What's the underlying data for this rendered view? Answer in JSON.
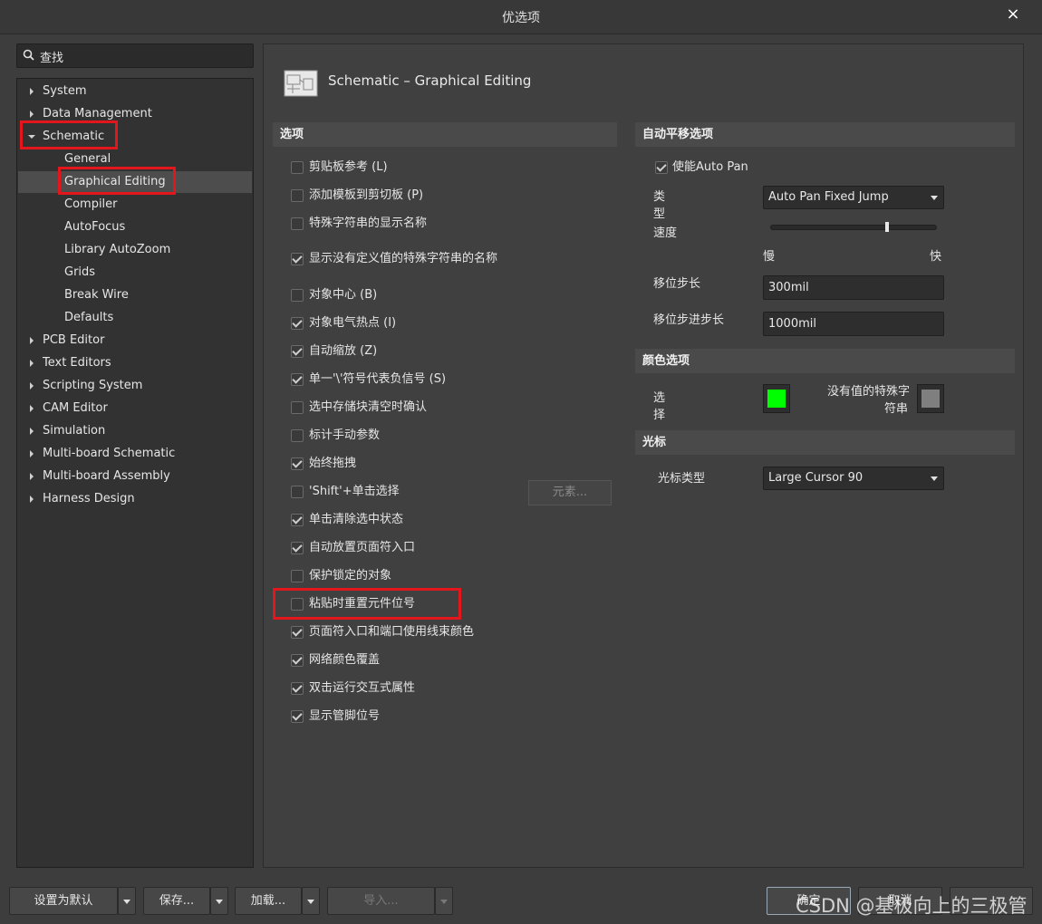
{
  "window": {
    "title": "优选项",
    "close": "×"
  },
  "search": {
    "placeholder": "查找"
  },
  "tree": [
    {
      "label": "System",
      "level": 0,
      "state": "collapsed"
    },
    {
      "label": "Data Management",
      "level": 0,
      "state": "collapsed"
    },
    {
      "label": "Schematic",
      "level": 0,
      "state": "expanded"
    },
    {
      "label": "General",
      "level": 1
    },
    {
      "label": "Graphical Editing",
      "level": 1,
      "selected": true
    },
    {
      "label": "Compiler",
      "level": 1
    },
    {
      "label": "AutoFocus",
      "level": 1
    },
    {
      "label": "Library AutoZoom",
      "level": 1
    },
    {
      "label": "Grids",
      "level": 1
    },
    {
      "label": "Break Wire",
      "level": 1
    },
    {
      "label": "Defaults",
      "level": 1
    },
    {
      "label": "PCB Editor",
      "level": 0,
      "state": "collapsed"
    },
    {
      "label": "Text Editors",
      "level": 0,
      "state": "collapsed"
    },
    {
      "label": "Scripting System",
      "level": 0,
      "state": "collapsed"
    },
    {
      "label": "CAM Editor",
      "level": 0,
      "state": "collapsed"
    },
    {
      "label": "Simulation",
      "level": 0,
      "state": "collapsed"
    },
    {
      "label": "Multi-board Schematic",
      "level": 0,
      "state": "collapsed"
    },
    {
      "label": "Multi-board Assembly",
      "level": 0,
      "state": "collapsed"
    },
    {
      "label": "Harness Design",
      "level": 0,
      "state": "collapsed"
    }
  ],
  "page": {
    "title": "Schematic – Graphical Editing"
  },
  "options": {
    "header": "选项",
    "items": [
      {
        "label": "剪贴板参考 (L)",
        "checked": false
      },
      {
        "label": "添加模板到剪切板 (P)",
        "checked": false
      },
      {
        "label": "特殊字符串的显示名称",
        "checked": false
      },
      {
        "label": "显示没有定义值的特殊字符串的名称",
        "checked": true
      },
      {
        "label": "对象中心 (B)",
        "checked": false
      },
      {
        "label": "对象电气热点 (I)",
        "checked": true
      },
      {
        "label": "自动缩放 (Z)",
        "checked": true
      },
      {
        "label": "单一'\\'符号代表负信号 (S)",
        "checked": true
      },
      {
        "label": "选中存储块清空时确认",
        "checked": false
      },
      {
        "label": "标计手动参数",
        "checked": false
      },
      {
        "label": "始终拖拽",
        "checked": true
      },
      {
        "label": "'Shift'+单击选择",
        "checked": false
      },
      {
        "label": "单击清除选中状态",
        "checked": true
      },
      {
        "label": "自动放置页面符入口",
        "checked": true
      },
      {
        "label": "保护锁定的对象",
        "checked": false
      },
      {
        "label": "粘贴时重置元件位号",
        "checked": false
      },
      {
        "label": "页面符入口和端口使用线束颜色",
        "checked": true
      },
      {
        "label": "网络颜色覆盖",
        "checked": true
      },
      {
        "label": "双击运行交互式属性",
        "checked": true
      },
      {
        "label": "显示管脚位号",
        "checked": true
      }
    ],
    "elements_button": "元素..."
  },
  "autopan": {
    "header": "自动平移选项",
    "enable_label": "使能Auto Pan",
    "enable_checked": true,
    "type_label_1": "类",
    "type_label_2": "型",
    "type_value": "Auto Pan Fixed Jump",
    "speed_label": "速度",
    "speed_fraction": 0.7,
    "slow_label": "慢",
    "fast_label": "快",
    "step_label": "移位步长",
    "step_value": "300mil",
    "shift_step_label": "移位步进步长",
    "shift_step_value": "1000mil"
  },
  "colors": {
    "header": "颜色选项",
    "select_label_1": "选",
    "select_label_2": "择",
    "select_color": "#00ff00",
    "undefined_label_1": "没有值的特殊字",
    "undefined_label_2": "符串",
    "undefined_color": "#7f7f7f"
  },
  "cursor": {
    "header": "光标",
    "type_label": "光标类型",
    "type_value": "Large Cursor 90"
  },
  "footer": {
    "set_default": "设置为默认",
    "save": "保存...",
    "load": "加载...",
    "import": "导入...",
    "ok": "确定",
    "cancel": "取消"
  },
  "watermark": "CSDN @基极向上的三极管",
  "highlight_color": "#e3161c"
}
